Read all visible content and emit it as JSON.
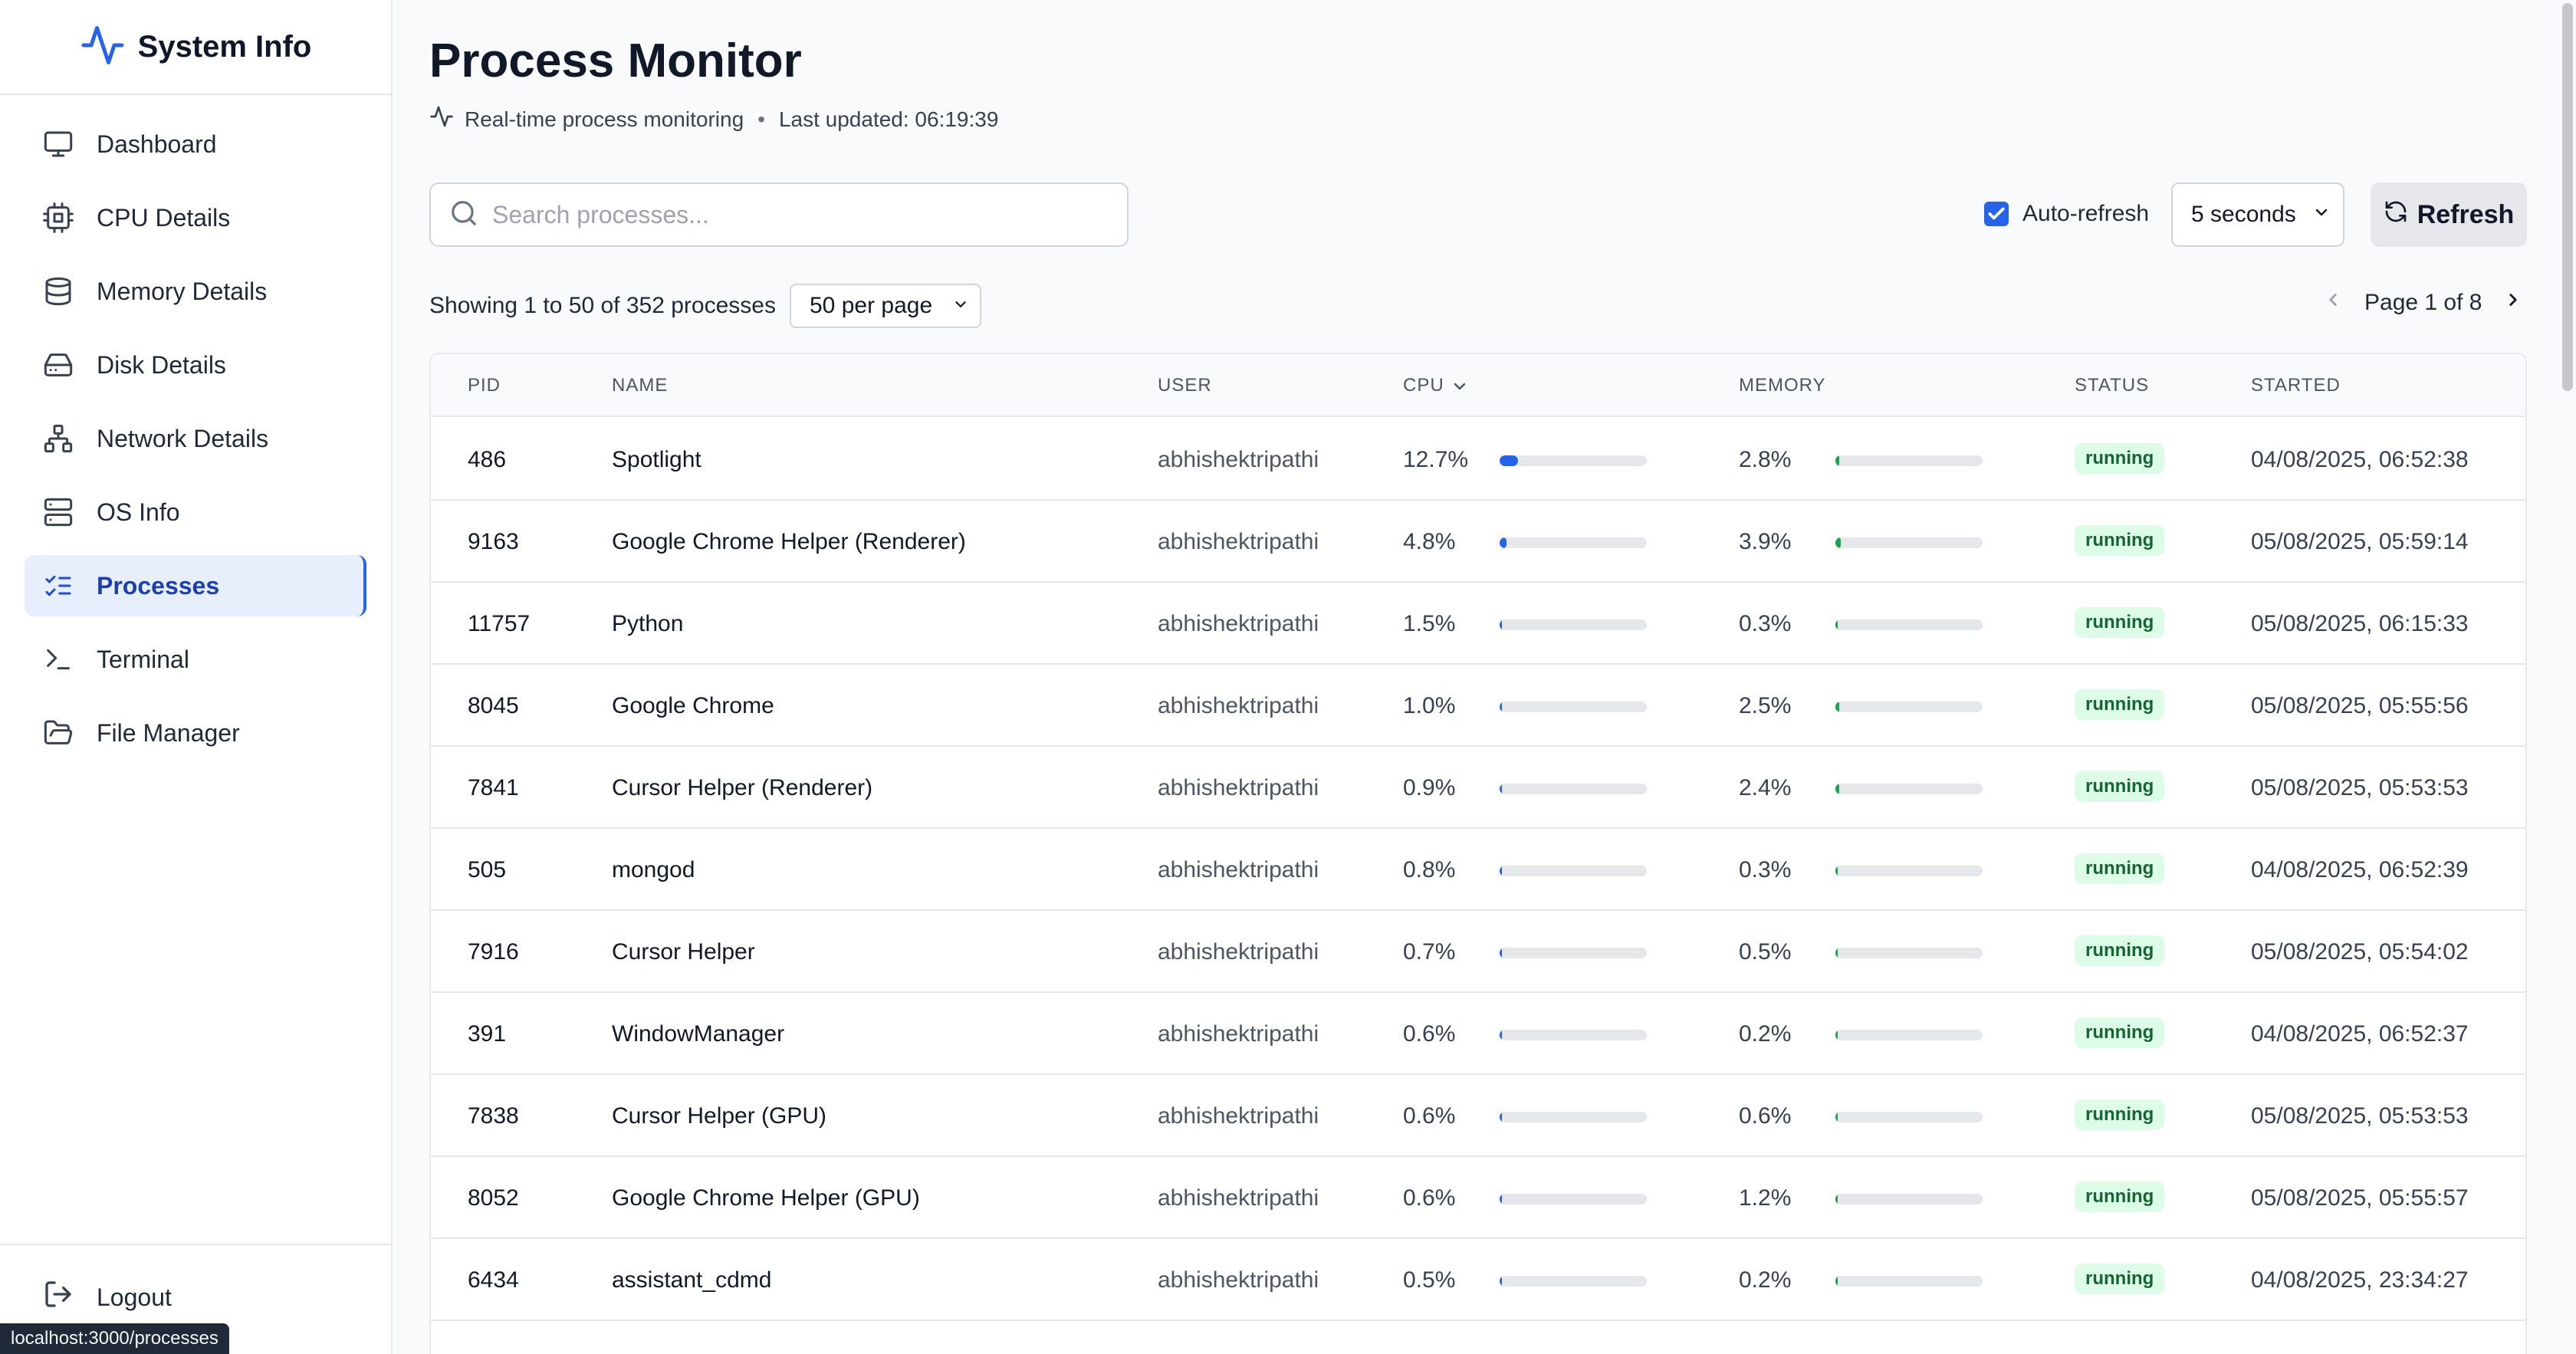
{
  "app": {
    "brand": "System Info"
  },
  "sidebar": {
    "items": [
      {
        "label": "Dashboard",
        "icon": "monitor-icon",
        "active": false
      },
      {
        "label": "CPU Details",
        "icon": "cpu-icon",
        "active": false
      },
      {
        "label": "Memory Details",
        "icon": "database-icon",
        "active": false
      },
      {
        "label": "Disk Details",
        "icon": "hard-drive-icon",
        "active": false
      },
      {
        "label": "Network Details",
        "icon": "network-icon",
        "active": false
      },
      {
        "label": "OS Info",
        "icon": "server-icon",
        "active": false
      },
      {
        "label": "Processes",
        "icon": "list-checks-icon",
        "active": true
      },
      {
        "label": "Terminal",
        "icon": "terminal-icon",
        "active": false
      },
      {
        "label": "File Manager",
        "icon": "folder-icon",
        "active": false
      }
    ],
    "logout": "Logout"
  },
  "status_url": "localhost:3000/processes",
  "header": {
    "title": "Process Monitor",
    "subtitle": "Real-time process monitoring",
    "last_updated": "Last updated: 06:19:39"
  },
  "controls": {
    "search_placeholder": "Search processes...",
    "search_value": "",
    "auto_refresh_label": "Auto-refresh",
    "auto_refresh_checked": true,
    "interval": "5 seconds",
    "refresh_label": "Refresh",
    "showing": "Showing 1 to 50 of 352 processes",
    "per_page": "50 per page",
    "page": "Page 1 of 8"
  },
  "colors": {
    "accent": "#2563eb",
    "memory": "#16a34a",
    "badge_bg": "#dcfce7",
    "badge_text": "#166534"
  },
  "table": {
    "columns": [
      "PID",
      "NAME",
      "USER",
      "CPU",
      "MEMORY",
      "STATUS",
      "STARTED"
    ],
    "rows": [
      {
        "pid": "486",
        "name": "Spotlight",
        "user": "abhishektripathi",
        "cpu": "12.7%",
        "cpu_value": 12.7,
        "mem": "2.8%",
        "mem_value": 2.8,
        "status": "running",
        "started": "04/08/2025, 06:52:38"
      },
      {
        "pid": "9163",
        "name": "Google Chrome Helper (Renderer)",
        "user": "abhishektripathi",
        "cpu": "4.8%",
        "cpu_value": 4.8,
        "mem": "3.9%",
        "mem_value": 3.9,
        "status": "running",
        "started": "05/08/2025, 05:59:14"
      },
      {
        "pid": "11757",
        "name": "Python",
        "user": "abhishektripathi",
        "cpu": "1.5%",
        "cpu_value": 1.5,
        "mem": "0.3%",
        "mem_value": 0.3,
        "status": "running",
        "started": "05/08/2025, 06:15:33"
      },
      {
        "pid": "8045",
        "name": "Google Chrome",
        "user": "abhishektripathi",
        "cpu": "1.0%",
        "cpu_value": 1.0,
        "mem": "2.5%",
        "mem_value": 2.5,
        "status": "running",
        "started": "05/08/2025, 05:55:56"
      },
      {
        "pid": "7841",
        "name": "Cursor Helper (Renderer)",
        "user": "abhishektripathi",
        "cpu": "0.9%",
        "cpu_value": 0.9,
        "mem": "2.4%",
        "mem_value": 2.4,
        "status": "running",
        "started": "05/08/2025, 05:53:53"
      },
      {
        "pid": "505",
        "name": "mongod",
        "user": "abhishektripathi",
        "cpu": "0.8%",
        "cpu_value": 0.8,
        "mem": "0.3%",
        "mem_value": 0.3,
        "status": "running",
        "started": "04/08/2025, 06:52:39"
      },
      {
        "pid": "7916",
        "name": "Cursor Helper",
        "user": "abhishektripathi",
        "cpu": "0.7%",
        "cpu_value": 0.7,
        "mem": "0.5%",
        "mem_value": 0.5,
        "status": "running",
        "started": "05/08/2025, 05:54:02"
      },
      {
        "pid": "391",
        "name": "WindowManager",
        "user": "abhishektripathi",
        "cpu": "0.6%",
        "cpu_value": 0.6,
        "mem": "0.2%",
        "mem_value": 0.2,
        "status": "running",
        "started": "04/08/2025, 06:52:37"
      },
      {
        "pid": "7838",
        "name": "Cursor Helper (GPU)",
        "user": "abhishektripathi",
        "cpu": "0.6%",
        "cpu_value": 0.6,
        "mem": "0.6%",
        "mem_value": 0.6,
        "status": "running",
        "started": "05/08/2025, 05:53:53"
      },
      {
        "pid": "8052",
        "name": "Google Chrome Helper (GPU)",
        "user": "abhishektripathi",
        "cpu": "0.6%",
        "cpu_value": 0.6,
        "mem": "1.2%",
        "mem_value": 1.2,
        "status": "running",
        "started": "05/08/2025, 05:55:57"
      },
      {
        "pid": "6434",
        "name": "assistant_cdmd",
        "user": "abhishektripathi",
        "cpu": "0.5%",
        "cpu_value": 0.5,
        "mem": "0.2%",
        "mem_value": 0.2,
        "status": "running",
        "started": "04/08/2025, 23:34:27"
      }
    ]
  }
}
